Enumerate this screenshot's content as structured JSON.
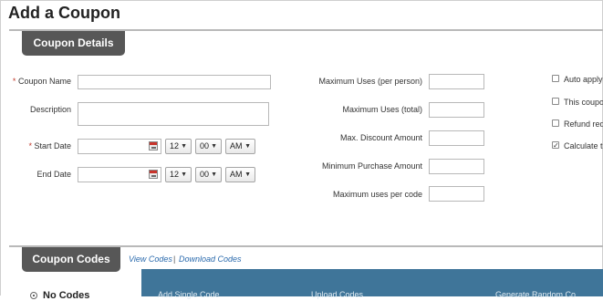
{
  "page": {
    "title": "Add a Coupon"
  },
  "coupon_details": {
    "tab_label": "Coupon Details",
    "coupon_name": {
      "label": "Coupon Name",
      "value": ""
    },
    "description": {
      "label": "Description",
      "value": ""
    },
    "start_date": {
      "label": "Start Date",
      "value": "",
      "hour": "12",
      "minute": "00",
      "ampm": "AM",
      "required": "*"
    },
    "end_date": {
      "label": "End Date",
      "value": "",
      "hour": "12",
      "minute": "00",
      "ampm": "AM"
    },
    "required_marker": "*",
    "max_uses_person": {
      "label": "Maximum Uses (per person)",
      "value": ""
    },
    "max_uses_total": {
      "label": "Maximum Uses (total)",
      "value": ""
    },
    "max_discount": {
      "label": "Max. Discount Amount",
      "value": ""
    },
    "min_purchase": {
      "label": "Minimum Purchase Amount",
      "value": ""
    },
    "max_uses_code": {
      "label": "Maximum uses per code",
      "value": ""
    },
    "checkboxes": [
      {
        "label": "Auto apply",
        "checked": false
      },
      {
        "label": "This coupo",
        "checked": false
      },
      {
        "label": "Refund req",
        "checked": false
      },
      {
        "label": "Calculate t",
        "checked": true
      }
    ]
  },
  "coupon_codes": {
    "tab_label": "Coupon Codes",
    "view_codes": "View Codes",
    "separator": "|",
    "download_codes": "Download Codes",
    "option_no_codes": "No Codes",
    "panel_items": [
      "Add Single Code",
      "Upload Codes",
      "Generate Random Co"
    ]
  },
  "icons": {
    "calendar": "calendar-icon",
    "select_arrow": "chevron-down-icon"
  },
  "colors": {
    "tab_bg": "#575757",
    "link": "#2a6aad",
    "panel": "#3f7599",
    "required": "#c0392b"
  }
}
